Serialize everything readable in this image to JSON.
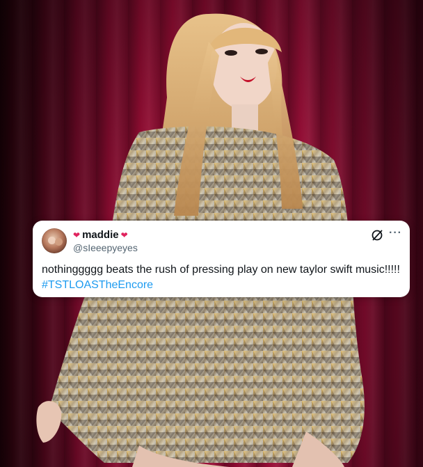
{
  "tweet": {
    "display_name": "maddie",
    "handle": "@sIeeepyeyes",
    "name_emoji": "❤️‍🔥",
    "text": "nothinggggg beats the rush of pressing play on new taylor swift music!!!!!",
    "hashtag": "#TSTLOASTheEncore",
    "more_glyph": "···"
  },
  "colors": {
    "curtain": "#a10f3a",
    "link": "#1d9bf0",
    "text": "#0f1419",
    "secondary": "#536471",
    "card": "#ffffff"
  },
  "icons": [
    "heart-fire-icon",
    "grok-icon",
    "more-icon"
  ]
}
